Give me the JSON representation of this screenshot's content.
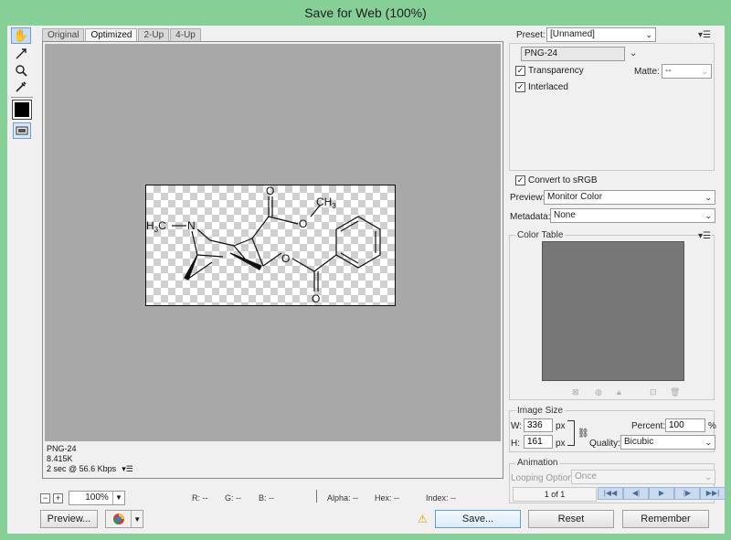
{
  "window": {
    "title": "Save for Web (100%)"
  },
  "tabs": [
    {
      "label": "Original",
      "active": false
    },
    {
      "label": "Optimized",
      "active": true
    },
    {
      "label": "2-Up",
      "active": false
    },
    {
      "label": "4-Up",
      "active": false
    }
  ],
  "tools": [
    "hand-tool-icon",
    "slice-select-tool-icon",
    "zoom-tool-icon",
    "eyedropper-tool-icon",
    "eyedropper-color-swatch",
    "toggle-slices-visibility-icon"
  ],
  "molecule": {
    "labels": {
      "methyl_n": "H",
      "methyl_n_sub": "3",
      "methyl_n_c": "C",
      "nitrogen": "N",
      "ester_o": "O",
      "ester_o2": "O",
      "ester_o3": "O",
      "ester_o4": "O",
      "ch3_c": "CH",
      "ch3_sub": "3"
    }
  },
  "image_info": {
    "format": "PNG-24",
    "size": "8.415K",
    "speed": "2 sec @ 56.6 Kbps"
  },
  "zoom": {
    "value": "100%",
    "minus": "−",
    "plus": "+"
  },
  "readouts": {
    "r": "R: --",
    "g": "G: --",
    "b": "B: --",
    "alpha": "Alpha: --",
    "hex": "Hex: --",
    "index": "Index: --"
  },
  "buttons": {
    "preview": "Preview...",
    "save": "Save...",
    "reset": "Reset",
    "remember": "Remember"
  },
  "settings": {
    "preset_label": "Preset:",
    "preset_value": "[Unnamed]",
    "format_value": "PNG-24",
    "transparency_label": "Transparency",
    "transparency_checked": true,
    "matte_label": "Matte:",
    "matte_value": "--",
    "interlaced_label": "Interlaced",
    "interlaced_checked": true,
    "convert_srgb_label": "Convert to sRGB",
    "convert_srgb_checked": true,
    "preview_label": "Preview:",
    "preview_value": "Monitor Color",
    "metadata_label": "Metadata:",
    "metadata_value": "None"
  },
  "color_table": {
    "title": "Color Table"
  },
  "image_size": {
    "title": "Image Size",
    "w_label": "W:",
    "w_value": "336",
    "h_label": "H:",
    "h_value": "161",
    "unit": "px",
    "percent_label": "Percent:",
    "percent_value": "100",
    "percent_unit": "%",
    "quality_label": "Quality:",
    "quality_value": "Bicubic"
  },
  "animation": {
    "title": "Animation",
    "looping_label": "Looping Options:",
    "looping_value": "Once",
    "frame_counter": "1 of 1"
  },
  "colors": {
    "title_bar": "#86cf96",
    "canvas_bg": "#a8a8a8",
    "color_table_bg": "#777777",
    "accent": "#5e9ed6"
  }
}
